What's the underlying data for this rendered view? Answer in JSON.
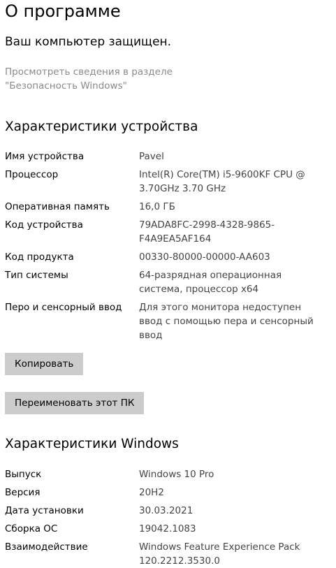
{
  "page": {
    "title": "О программе",
    "protected_text": "Ваш компьютер защищен.",
    "security_link_line1": "Просмотреть сведения в разделе",
    "security_link_line2": "\"Безопасность Windows\""
  },
  "device": {
    "heading": "Характеристики устройства",
    "rows": [
      {
        "label": "Имя устройства",
        "value": "Pavel"
      },
      {
        "label": "Процессор",
        "value": "Intel(R) Core(TM) i5-9600KF CPU @\n3.70GHz   3.70 GHz"
      },
      {
        "label": "Оперативная память",
        "value": "16,0 ГБ"
      },
      {
        "label": "Код устройства",
        "value": "79ADA8FC-2998-4328-9865-\nF4A9EA5AF164"
      },
      {
        "label": "Код продукта",
        "value": "00330-80000-00000-AA603"
      },
      {
        "label": "Тип системы",
        "value": "64-разрядная операционная\nсистема, процессор x64"
      },
      {
        "label": "Перо и сенсорный ввод",
        "value": "Для этого монитора недоступен\nввод с помощью пера и сенсорный\nввод"
      }
    ],
    "copy_button": "Копировать",
    "rename_button": "Переименовать этот ПК"
  },
  "windows": {
    "heading": "Характеристики Windows",
    "rows": [
      {
        "label": "Выпуск",
        "value": "Windows 10 Pro"
      },
      {
        "label": "Версия",
        "value": "20H2"
      },
      {
        "label": "Дата установки",
        "value": "30.03.2021"
      },
      {
        "label": "Сборка ОС",
        "value": "19042.1083"
      },
      {
        "label": "Взаимодействие",
        "value": "Windows Feature Experience Pack\n120.2212.3530.0"
      }
    ]
  }
}
